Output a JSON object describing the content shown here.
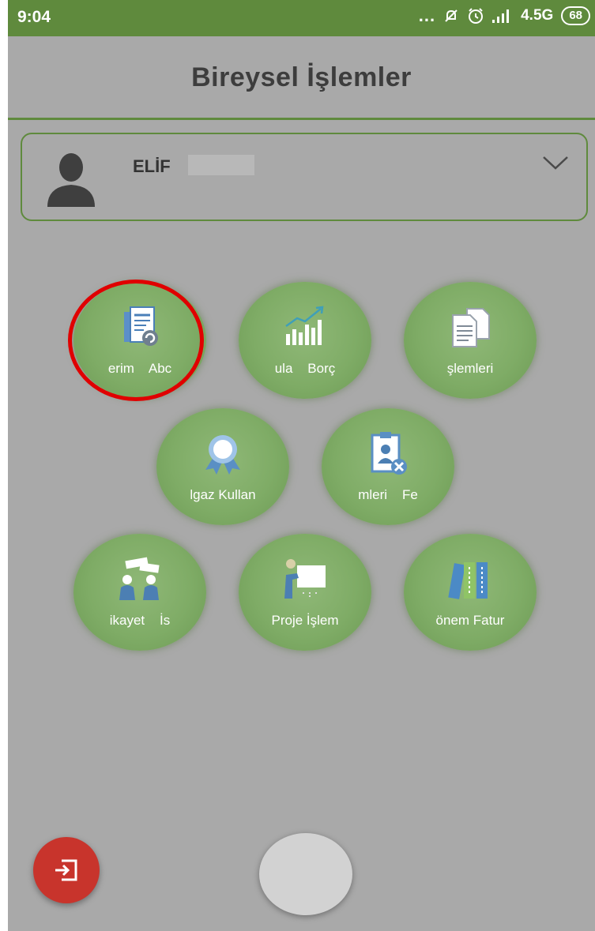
{
  "status_bar": {
    "time": "9:04",
    "dots": "...",
    "network": "4.5G",
    "battery": "68"
  },
  "header": {
    "title": "Bireysel İşlemler"
  },
  "user": {
    "name": "ELİF"
  },
  "tiles": [
    {
      "label": "erim    Abc",
      "icon": "document-refresh-icon"
    },
    {
      "label": "ula    Borç",
      "icon": "bar-chart-growth-icon"
    },
    {
      "label": "şlemleri",
      "icon": "documents-copy-icon"
    },
    {
      "label": "lgaz Kullan",
      "icon": "award-badge-icon"
    },
    {
      "label": "mleri    Fe",
      "icon": "id-card-cancel-icon"
    },
    {
      "label": "ikayet    İs",
      "icon": "people-discussion-icon"
    },
    {
      "label": "Proje İşlem",
      "icon": "presentation-board-icon"
    },
    {
      "label": "önem Fatur",
      "icon": "binders-icon"
    }
  ],
  "colors": {
    "accent": "#5f8a3d",
    "tile": "#7fac66",
    "highlight": "#e00000",
    "logout": "#c8342c"
  }
}
